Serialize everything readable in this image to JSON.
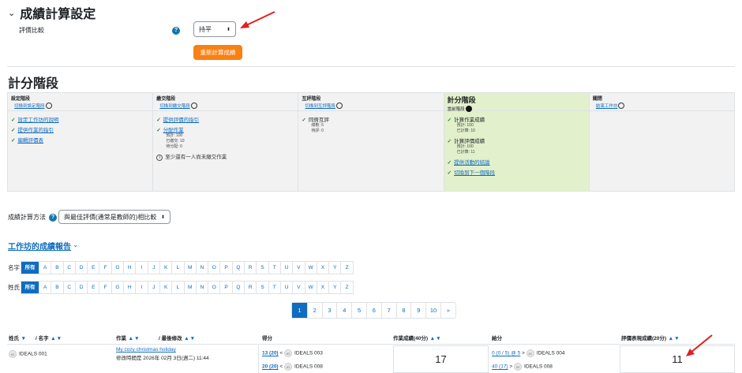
{
  "grading_settings": {
    "title": "成績計算設定",
    "comparison_label": "評價比較",
    "comparison_value": "持平",
    "recalc_button": "重新計算成績"
  },
  "phases_title": "計分階段",
  "phases": [
    {
      "title": "設定階段",
      "switch": "切換到設定階段",
      "tasks": [
        {
          "label": "設定工作坊的說明"
        },
        {
          "label": "提供作業的指引"
        },
        {
          "label": "編輯評價表"
        }
      ]
    },
    {
      "title": "繳交階段",
      "switch": "切換到繳交階段",
      "tasks": [
        {
          "label": "提供評價的指引"
        },
        {
          "label": "分配作業",
          "sub": [
            "預計: 100",
            "已繳交: 10",
            "待分配: 0"
          ]
        }
      ],
      "info": "至少還有一人尚未繳交作業"
    },
    {
      "title": "互評階段",
      "switch": "切換到互評階段",
      "tasks": [
        {
          "label": "同儕互評",
          "sub": [
            "總數: 5",
            "待評: 0"
          ]
        }
      ]
    },
    {
      "title": "計分階段",
      "current": "當前階段",
      "tasks": [
        {
          "label": "計算作業成績",
          "sub": [
            "預計: 100",
            "已計算: 10"
          ]
        },
        {
          "label": "計算評價成績",
          "sub": [
            "預計: 100",
            "已計算: 11"
          ]
        },
        {
          "label": "提供活動的結論"
        },
        {
          "label": "切換到下一個階段"
        }
      ]
    },
    {
      "title": "關閉",
      "switch": "結束工作坊",
      "tasks": []
    }
  ],
  "grading_method": {
    "label": "成績計算方法",
    "value": "與最佳評價(通常是教師的)相比較"
  },
  "report_title": "工作坊的成績報告",
  "initials": {
    "firstname_label": "名字",
    "lastname_label": "姓氏",
    "letters": [
      "所有",
      "A",
      "B",
      "C",
      "D",
      "E",
      "F",
      "G",
      "H",
      "I",
      "J",
      "K",
      "L",
      "M",
      "N",
      "O",
      "P",
      "Q",
      "R",
      "S",
      "T",
      "U",
      "V",
      "W",
      "X",
      "Y",
      "Z"
    ]
  },
  "pagination": [
    "1",
    "2",
    "3",
    "4",
    "5",
    "6",
    "7",
    "8",
    "9",
    "10",
    "»"
  ],
  "table": {
    "headers": {
      "lastname": "姓氏",
      "firstname": "/ 名字",
      "submission": "作業",
      "lastmodified": "/ 最後修改",
      "received": "得分",
      "subgrade": "作業成績(40分)",
      "given": "給分",
      "gradinggrade": "評價表現成績(20分)"
    },
    "row": {
      "avatar": "IO",
      "name": "IDEALS 001",
      "submission_title": "My cozy christmas holiday",
      "modified": "修改時間是 2026年 02月 3日(週二) 11:44",
      "received": [
        {
          "score": "13 (20)",
          "sep": "<",
          "who": "IDEALS 003"
        },
        {
          "score": "20 (20)",
          "sep": "<",
          "who": "IDEALS 008"
        }
      ],
      "submission_grade": "17",
      "given": [
        {
          "score": "0 (0 / 5) @ 5",
          "sep": ">",
          "who": "IDEALS 004"
        },
        {
          "score": "40 (17)",
          "sep": ">",
          "who": "IDEALS 008"
        }
      ],
      "grading_grade": "11"
    }
  }
}
